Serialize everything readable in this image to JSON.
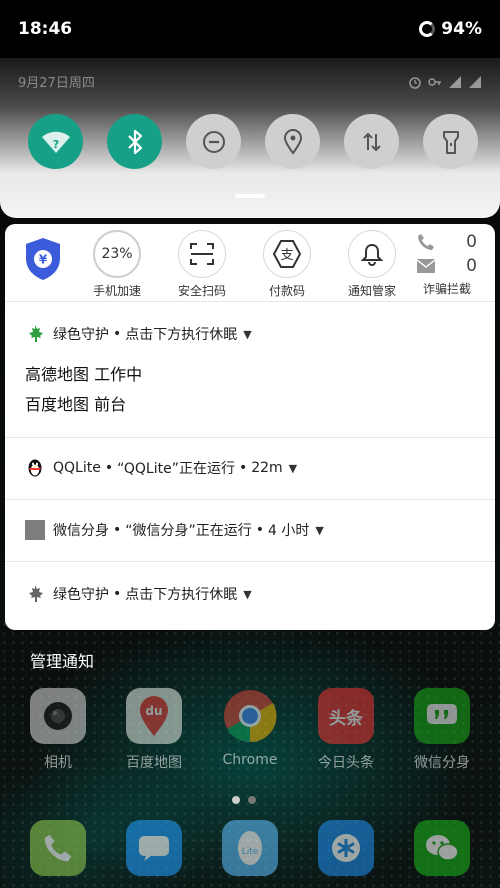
{
  "status_bar": {
    "time": "18:46",
    "battery": "94%"
  },
  "quick_settings": {
    "date": "9月27日周四",
    "toggles": [
      {
        "name": "wifi",
        "on": true
      },
      {
        "name": "bluetooth",
        "on": true
      },
      {
        "name": "do-not-disturb",
        "on": false
      },
      {
        "name": "location",
        "on": false
      },
      {
        "name": "mobile-data",
        "on": false
      },
      {
        "name": "flashlight",
        "on": false
      }
    ]
  },
  "shortcuts": {
    "boost_percent": "23%",
    "boost_label": "手机加速",
    "scan_label": "安全扫码",
    "pay_label": "付款码",
    "notify_label": "通知管家",
    "fraud_calls": "0",
    "fraud_sms": "0",
    "fraud_label": "诈骗拦截"
  },
  "notifications": [
    {
      "app": "绿色守护",
      "text": "点击下方执行休眠",
      "lines": [
        "高德地图 工作中",
        "百度地图 前台"
      ]
    },
    {
      "app": "QQLite",
      "text": "“QQLite”正在运行",
      "time": "22m"
    },
    {
      "app": "微信分身",
      "text": "“微信分身”正在运行",
      "time": "4 小时"
    },
    {
      "app": "绿色守护",
      "text": "点击下方执行休眠"
    }
  ],
  "separator": "•",
  "manage_label": "管理通知",
  "home_apps": [
    {
      "label": "相机"
    },
    {
      "label": "百度地图"
    },
    {
      "label": "Chrome"
    },
    {
      "label": "今日头条"
    },
    {
      "label": "微信分身"
    }
  ],
  "toutiao_icon_text": "头条",
  "baidu_icon_text": "du",
  "qq_icon_text": "Lite",
  "colors": {
    "accent": "#16a087",
    "shield": "#3b5bdb"
  }
}
